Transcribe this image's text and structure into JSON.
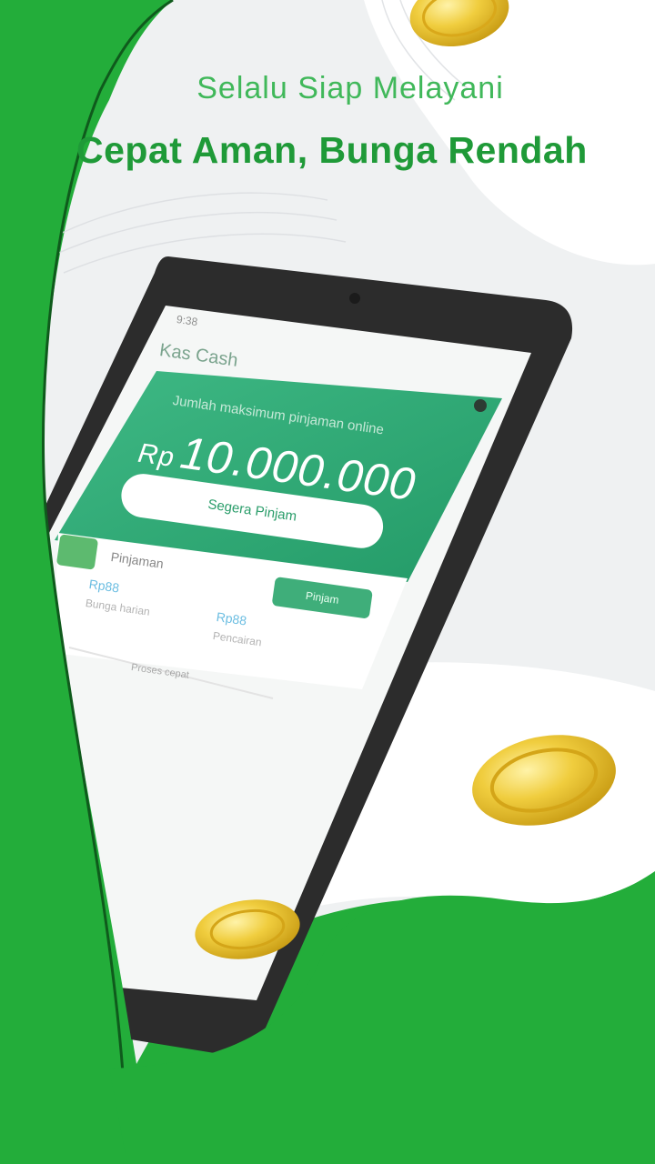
{
  "banner": {
    "tagline": "Selalu Siap Melayani",
    "headline": "Cepat Aman, Bunga Rendah"
  },
  "phone": {
    "status_time": "9:38",
    "app_title": "Kas Cash",
    "loan_banner": {
      "subtitle": "Jumlah maksimum pinjaman online",
      "currency": "Rp",
      "amount": "10.000.000",
      "apply_button": "Segera Pinjam"
    },
    "card": {
      "label": "Pinjaman",
      "stat_1_value": "Rp88",
      "stat_1_label": "Bunga harian",
      "stat_2_value": "Rp88",
      "stat_2_label": "Pencairan",
      "action_button": "Pinjam"
    },
    "footer_label": "Proses cepat"
  },
  "colors": {
    "brand_green": "#23ad3a",
    "banner_green": "#2fa872",
    "headline_green": "#1f9a38",
    "coin_gold": "#e8c13a"
  }
}
